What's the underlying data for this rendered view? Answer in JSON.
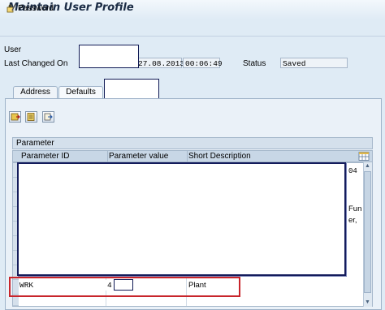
{
  "window": {
    "title": "Maintain User Profile"
  },
  "toolbar": {
    "password_label": "Password"
  },
  "header": {
    "user_label": "User",
    "last_changed_label": "Last Changed On",
    "last_changed_date": "27.08.2013",
    "last_changed_time": "00:06:49",
    "status_label": "Status",
    "status_value": "Saved"
  },
  "tabs": [
    {
      "label": "Address"
    },
    {
      "label": "Defaults"
    }
  ],
  "table": {
    "title": "Parameter",
    "columns": [
      "Parameter ID",
      "Parameter value",
      "Short Description"
    ],
    "edge_fragments": [
      "04",
      "Fun",
      "er,"
    ],
    "rows": [
      {
        "param_id": "WRK",
        "param_value": "4",
        "short_description": "Plant"
      }
    ]
  },
  "colors": {
    "highlight": "#c8252b",
    "mask_border": "#141c5c",
    "background": "#dfebf5"
  },
  "icons": [
    "password-edit-icon",
    "details-icon",
    "list-icon",
    "export-icon",
    "column-settings-icon"
  ]
}
